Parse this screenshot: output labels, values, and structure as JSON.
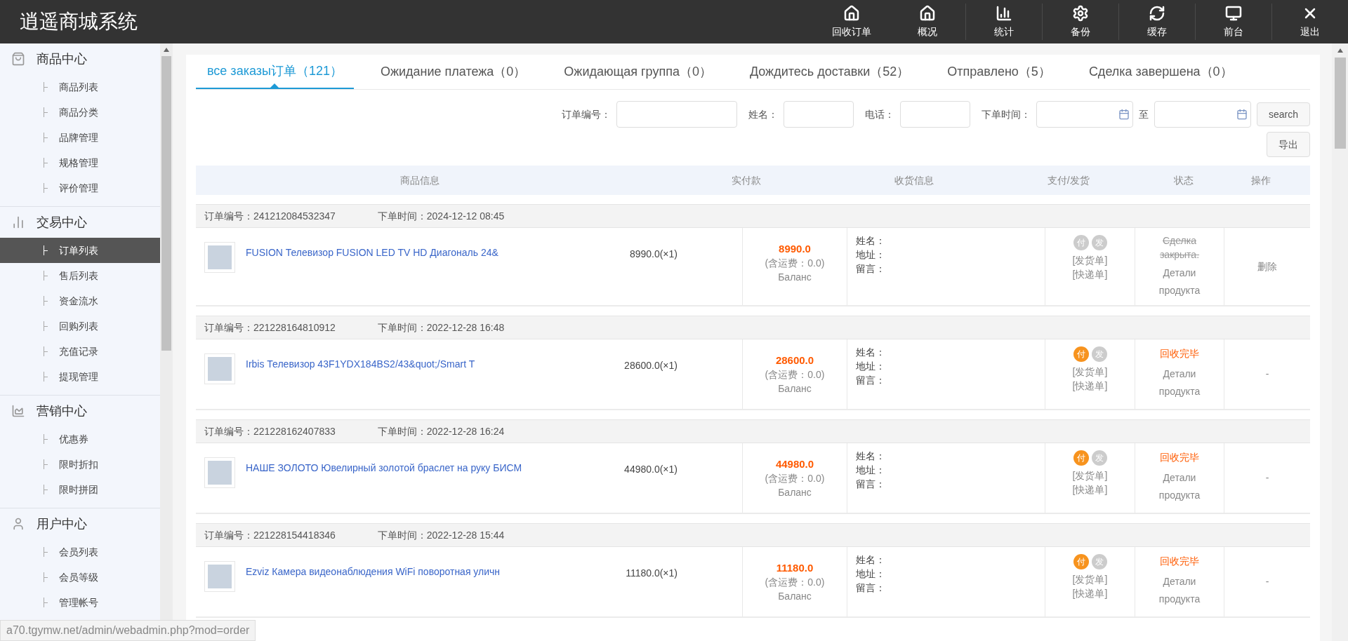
{
  "header": {
    "title": "逍遥商城系统",
    "nav": [
      {
        "label": "回收订单"
      },
      {
        "label": "概况"
      },
      {
        "label": "统计"
      },
      {
        "label": "备份"
      },
      {
        "label": "缓存"
      },
      {
        "label": "前台"
      },
      {
        "label": "退出"
      }
    ]
  },
  "sidebar": {
    "groups": [
      {
        "title": "商品中心",
        "items": [
          {
            "label": "商品列表",
            "selected": false
          },
          {
            "label": "商品分类",
            "selected": false
          },
          {
            "label": "品牌管理",
            "selected": false
          },
          {
            "label": "规格管理",
            "selected": false
          },
          {
            "label": "评价管理",
            "selected": false
          }
        ]
      },
      {
        "title": "交易中心",
        "items": [
          {
            "label": "订单列表",
            "selected": true
          },
          {
            "label": "售后列表",
            "selected": false
          },
          {
            "label": "资金流水",
            "selected": false
          },
          {
            "label": "回购列表",
            "selected": false
          },
          {
            "label": "充值记录",
            "selected": false
          },
          {
            "label": "提现管理",
            "selected": false
          }
        ]
      },
      {
        "title": "营销中心",
        "items": [
          {
            "label": "优惠券",
            "selected": false
          },
          {
            "label": "限时折扣",
            "selected": false
          },
          {
            "label": "限时拼团",
            "selected": false
          }
        ]
      },
      {
        "title": "用户中心",
        "items": [
          {
            "label": "会员列表",
            "selected": false
          },
          {
            "label": "会员等级",
            "selected": false
          },
          {
            "label": "管理帐号",
            "selected": false
          }
        ]
      }
    ]
  },
  "tabs": [
    {
      "label": "все заказы订单（121）",
      "selected": true
    },
    {
      "label": "Ожидание платежа（0）",
      "selected": false
    },
    {
      "label": "Ожидающая группа（0）",
      "selected": false
    },
    {
      "label": "Дождитесь доставки（52）",
      "selected": false
    },
    {
      "label": "Отправлено（5）",
      "selected": false
    },
    {
      "label": "Сделка завершена（0）",
      "selected": false
    }
  ],
  "filters": {
    "fields": [
      {
        "label": "订单编号："
      },
      {
        "label": "姓名："
      },
      {
        "label": "电话："
      }
    ],
    "date_label": "下单时间：",
    "range_separator": "至",
    "search_button": "search",
    "export_button": "导出"
  },
  "table": {
    "columns": [
      "商品信息",
      "实付款",
      "收货信息",
      "支付/发货",
      "状态",
      "操作"
    ],
    "orders": [
      {
        "order_no_label": "订单编号：",
        "order_no": "241212084532347",
        "time_label": "下单时间：",
        "time": "2024-12-12 08:45",
        "product": "FUSION Телевизор FUSION LED TV HD Диагональ 24&",
        "unit_price": "8990.0(×1)",
        "paid_amount": "8990.0",
        "shipping": "(含运费：0.0)",
        "payment_method": "Баланс",
        "recipient_labels": [
          "姓名：",
          "地址：",
          "留言："
        ],
        "pay_mark": "付",
        "ship_mark": "发",
        "paid": false,
        "shipped": false,
        "invoice_link": "[发货单]",
        "express_link": "[快递单]",
        "status": {
          "kind": "closed",
          "text": "Сделка закрыта."
        },
        "details_link": "Детали продукта",
        "action": "删除"
      },
      {
        "order_no_label": "订单编号：",
        "order_no": "221228164810912",
        "time_label": "下单时间：",
        "time": "2022-12-28 16:48",
        "product": "Irbis Телевизор 43F1YDX184BS2/43&quot;/Smart T",
        "unit_price": "28600.0(×1)",
        "paid_amount": "28600.0",
        "shipping": "(含运费：0.0)",
        "payment_method": "Баланс",
        "recipient_labels": [
          "姓名：",
          "地址：",
          "留言："
        ],
        "pay_mark": "付",
        "ship_mark": "发",
        "paid": true,
        "shipped": false,
        "invoice_link": "[发货单]",
        "express_link": "[快递单]",
        "status": {
          "kind": "recycled",
          "text": "回收完毕"
        },
        "details_link": "Детали продукта",
        "action": "-"
      },
      {
        "order_no_label": "订单编号：",
        "order_no": "221228162407833",
        "time_label": "下单时间：",
        "time": "2022-12-28 16:24",
        "product": "НАШЕ ЗОЛОТО Ювелирный золотой браслет на руку БИСМ",
        "unit_price": "44980.0(×1)",
        "paid_amount": "44980.0",
        "shipping": "(含运费：0.0)",
        "payment_method": "Баланс",
        "recipient_labels": [
          "姓名：",
          "地址：",
          "留言："
        ],
        "pay_mark": "付",
        "ship_mark": "发",
        "paid": true,
        "shipped": false,
        "invoice_link": "[发货单]",
        "express_link": "[快递单]",
        "status": {
          "kind": "recycled",
          "text": "回收完毕"
        },
        "details_link": "Детали продукта",
        "action": "-"
      },
      {
        "order_no_label": "订单编号：",
        "order_no": "221228154418346",
        "time_label": "下单时间：",
        "time": "2022-12-28 15:44",
        "product": "Ezviz Камера видеонаблюдения WiFi поворотная уличн",
        "unit_price": "11180.0(×1)",
        "paid_amount": "11180.0",
        "shipping": "(含运费：0.0)",
        "payment_method": "Баланс",
        "recipient_labels": [
          "姓名：",
          "地址：",
          "留言："
        ],
        "pay_mark": "付",
        "ship_mark": "发",
        "paid": true,
        "shipped": false,
        "invoice_link": "[发货单]",
        "express_link": "[快递单]",
        "status": {
          "kind": "recycled",
          "text": "回收完毕"
        },
        "details_link": "Детали продукта",
        "action": "-"
      }
    ]
  },
  "status_url": "a70.tgymw.net/admin/webadmin.php?mod=order"
}
